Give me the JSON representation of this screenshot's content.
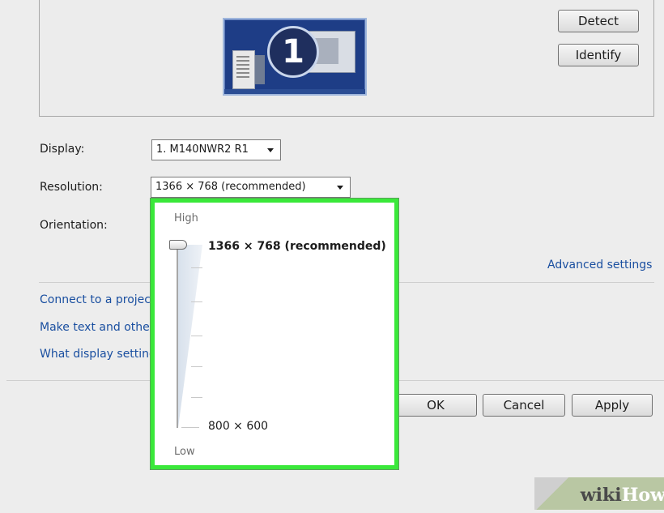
{
  "preview": {
    "monitor_number": "1",
    "detect_label": "Detect",
    "identify_label": "Identify"
  },
  "display": {
    "label": "Display:",
    "value": "1. M140NWR2 R1"
  },
  "resolution": {
    "label": "Resolution:",
    "value": "1366 × 768 (recommended)"
  },
  "orientation": {
    "label": "Orientation:"
  },
  "advanced_settings": "Advanced settings",
  "links": [
    "Connect to a projec",
    "Make text and othe",
    "What display setting"
  ],
  "buttons": {
    "ok": "OK",
    "cancel": "Cancel",
    "apply": "Apply"
  },
  "resolution_dropdown": {
    "high_label": "High",
    "low_label": "Low",
    "max_option": "1366 × 768 (recommended)",
    "min_option": "800 × 600",
    "selected_level": 1.0
  },
  "watermark": {
    "wiki": "wiki",
    "how": "How"
  },
  "colors": {
    "highlight_border": "#3ae83a",
    "link": "#1a4fa0",
    "monitor_bg": "#1e3d86"
  }
}
